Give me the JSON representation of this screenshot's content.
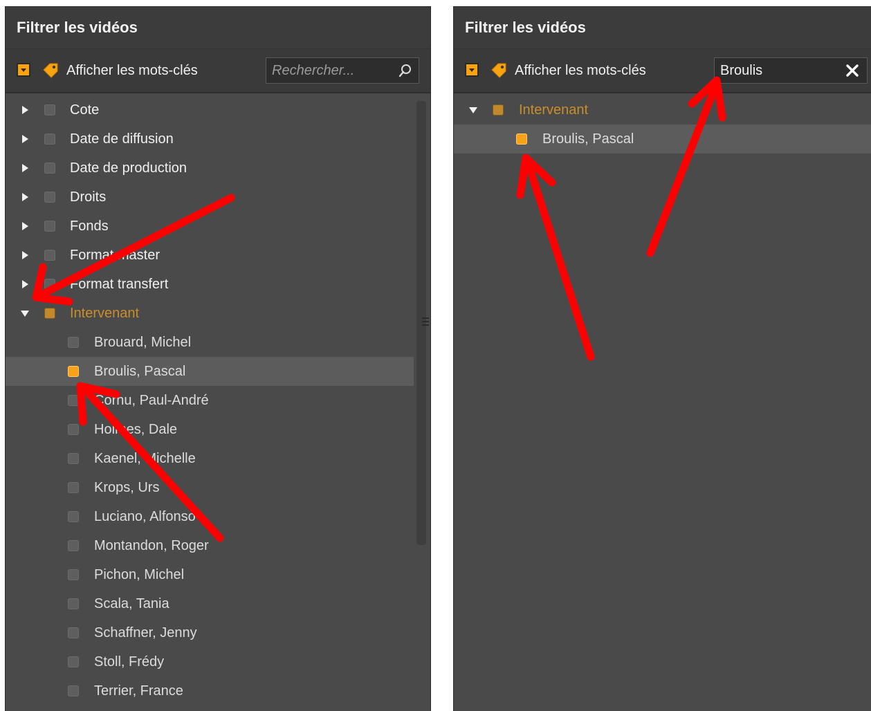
{
  "left_panel": {
    "title": "Filtrer les vidéos",
    "toolbar": {
      "label": "Afficher les mots-clés",
      "search_placeholder": "Rechercher...",
      "search_value": ""
    },
    "categories": [
      {
        "label": "Cote"
      },
      {
        "label": "Date de diffusion"
      },
      {
        "label": "Date de production"
      },
      {
        "label": "Droits"
      },
      {
        "label": "Fonds"
      },
      {
        "label": "Format master"
      },
      {
        "label": "Format transfert"
      }
    ],
    "expanded_category": {
      "label": "Intervenant",
      "children": [
        {
          "label": "Brouard, Michel",
          "checked": false
        },
        {
          "label": "Broulis, Pascal",
          "checked": true
        },
        {
          "label": "Cornu, Paul-André",
          "checked": false
        },
        {
          "label": "Holmes, Dale",
          "checked": false
        },
        {
          "label": "Kaenel, Michelle",
          "checked": false
        },
        {
          "label": "Krops, Urs",
          "checked": false
        },
        {
          "label": "Luciano, Alfonso",
          "checked": false
        },
        {
          "label": "Montandon, Roger",
          "checked": false
        },
        {
          "label": "Pichon, Michel",
          "checked": false
        },
        {
          "label": "Scala, Tania",
          "checked": false
        },
        {
          "label": "Schaffner, Jenny",
          "checked": false
        },
        {
          "label": "Stoll, Frédy",
          "checked": false
        },
        {
          "label": "Terrier, France",
          "checked": false
        }
      ]
    }
  },
  "right_panel": {
    "title": "Filtrer les vidéos",
    "toolbar": {
      "label": "Afficher les mots-clés",
      "search_value": "Broulis"
    },
    "expanded_category": {
      "label": "Intervenant",
      "children": [
        {
          "label": "Broulis, Pascal",
          "checked": true
        }
      ]
    }
  },
  "colors": {
    "panel_bg": "#4a4a4a",
    "header_bg": "#3c3c3c",
    "accent_orange": "#f8a21a",
    "category_orange": "#c98e2a",
    "annotation_red": "#ff0000"
  }
}
